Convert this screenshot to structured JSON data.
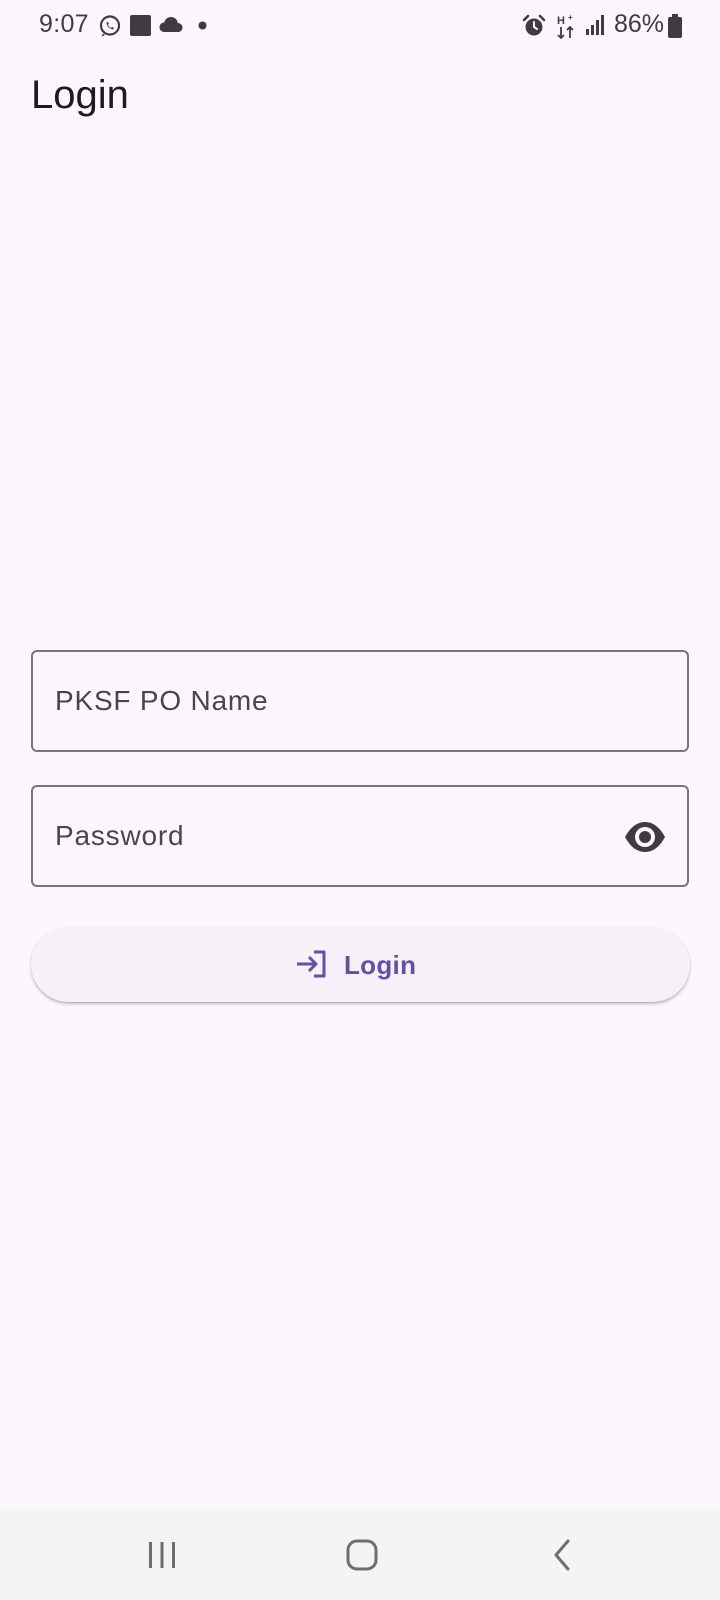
{
  "status_bar": {
    "time": "9:07",
    "battery_percent": "86%",
    "left_icons": [
      "whatsapp-icon",
      "square-notification-icon",
      "cloud-icon",
      "dot-icon"
    ],
    "right_icons": [
      "alarm-icon",
      "data-transfer-icon",
      "signal-icon",
      "battery-icon"
    ]
  },
  "app_bar": {
    "title": "Login"
  },
  "form": {
    "po_name_label": "PKSF PO Name",
    "po_name_value": "",
    "password_label": "Password",
    "password_value": "",
    "password_toggle_icon": "eye-icon",
    "login_button_label": "Login",
    "login_button_icon": "login-arrow-icon"
  },
  "nav_bar": {
    "items": [
      "recent-apps-icon",
      "home-icon",
      "back-icon"
    ]
  },
  "colors": {
    "background": "#fdf7fd",
    "accent": "#6750a4",
    "outline": "#79747e",
    "button_surface": "#f6f1f8",
    "nav_bar": "#f4f4f4"
  }
}
